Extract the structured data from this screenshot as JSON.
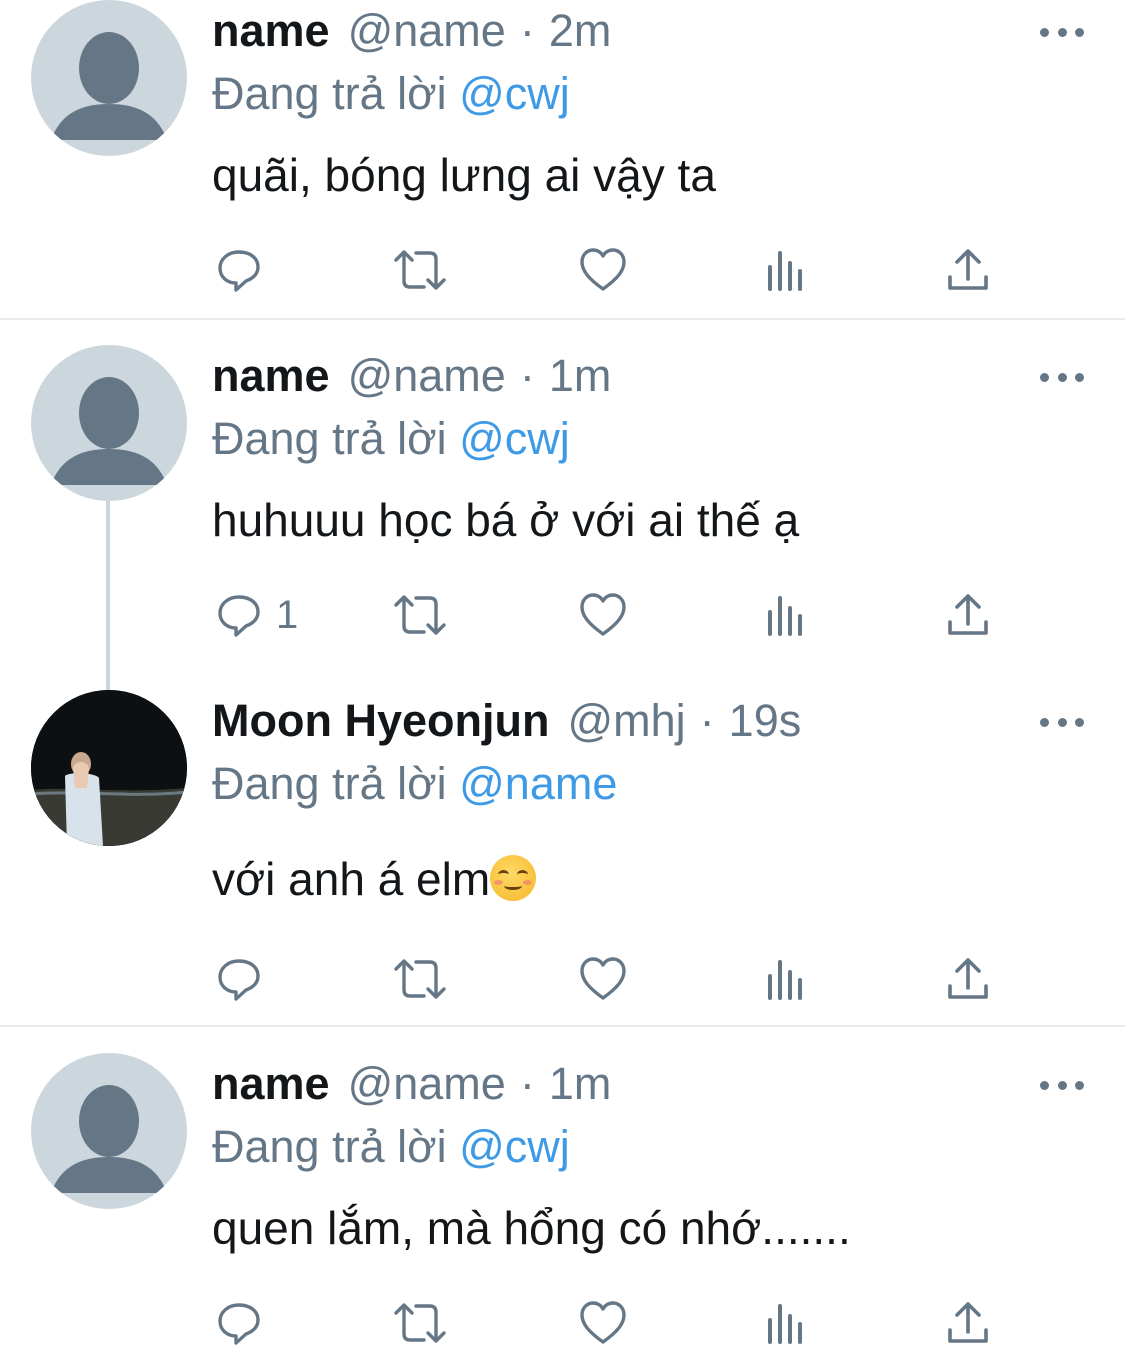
{
  "colors": {
    "mention": "#3f9ae6",
    "secondary": "#657786",
    "avatar_default": "#ccd6dd"
  },
  "icons": [
    "reply-icon",
    "retweet-icon",
    "like-icon",
    "views-icon",
    "share-icon",
    "more-icon",
    "default-avatar-icon"
  ],
  "tweets": [
    {
      "name": "name",
      "handle": "@name",
      "separator": "·",
      "time": "2m",
      "replying_prefix": "Đang trả lời",
      "replying_to": "@cwj",
      "text": "quãi, bóng lưng ai vậy ta",
      "reply_count": ""
    },
    {
      "name": "name",
      "handle": "@name",
      "separator": "·",
      "time": "1m",
      "replying_prefix": "Đang trả lời",
      "replying_to": "@cwj",
      "text": "huhuuu học bá ở với ai thế ạ",
      "reply_count": "1"
    },
    {
      "name": "Moon Hyeonjun",
      "handle": "@mhj",
      "separator": "·",
      "time": "19s",
      "replying_prefix": "Đang trả lời",
      "replying_to": "@name",
      "text": "với anh á elm",
      "emoji": "smiling-face-emoji",
      "reply_count": ""
    },
    {
      "name": "name",
      "handle": "@name",
      "separator": "·",
      "time": "1m",
      "replying_prefix": "Đang trả lời",
      "replying_to": "@cwj",
      "text": "quen lắm, mà hổng có nhớ.......",
      "reply_count": ""
    }
  ]
}
